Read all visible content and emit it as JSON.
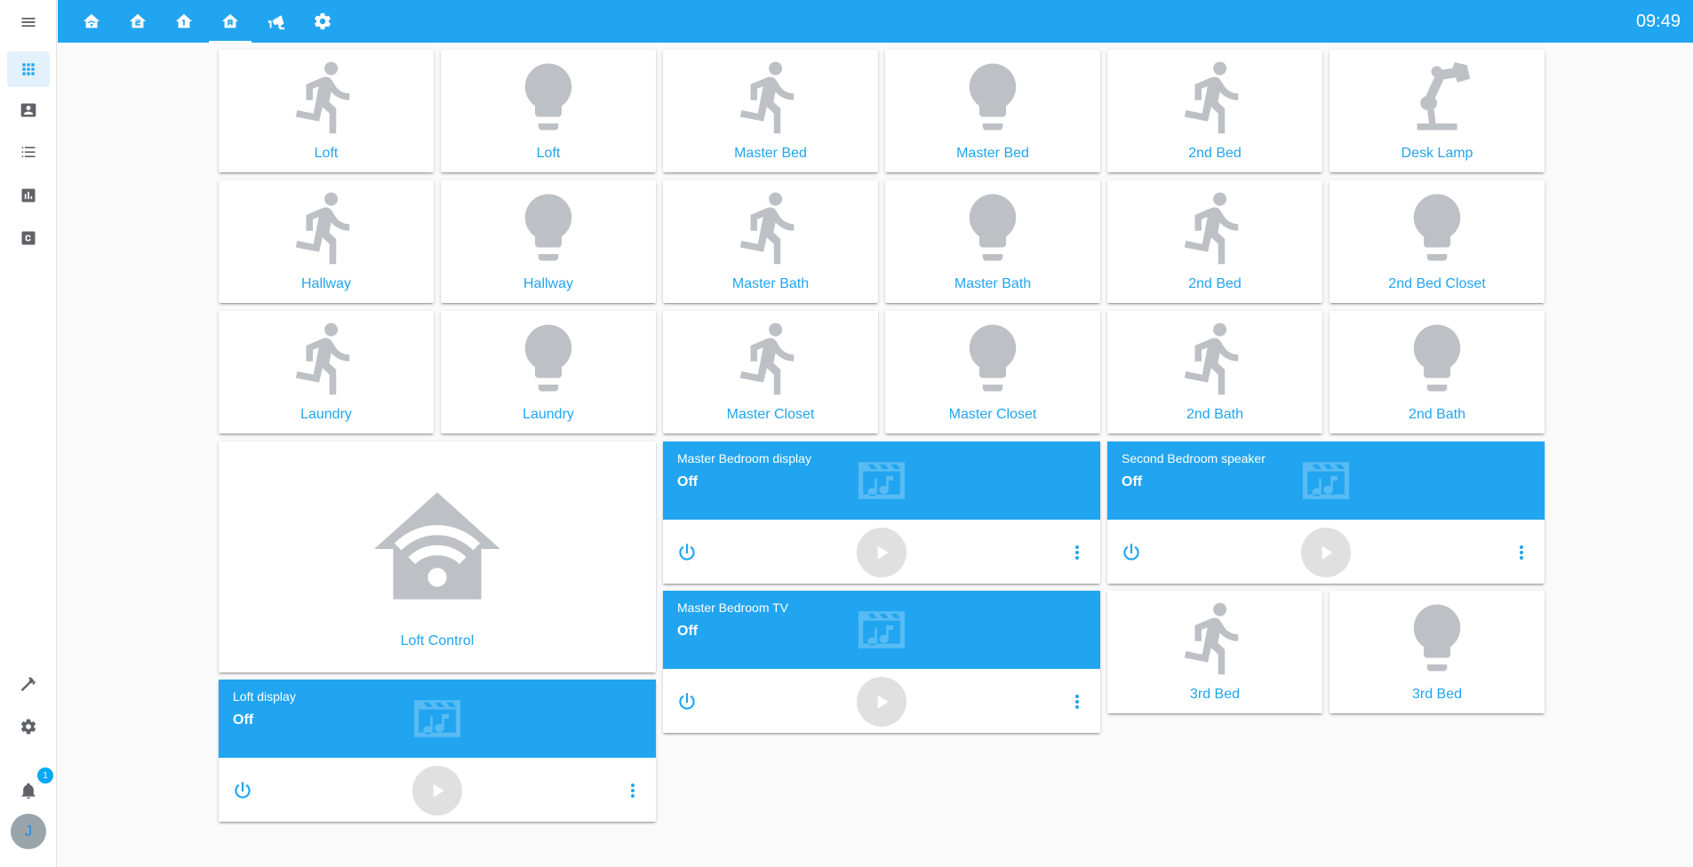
{
  "top": {
    "clock": "09:49",
    "tabs": [
      {
        "name": "home-wifi-icon"
      },
      {
        "name": "home-floor-2-icon"
      },
      {
        "name": "home-floor-1-icon"
      },
      {
        "name": "home-floor-a-icon",
        "active": true
      },
      {
        "name": "cctv-icon"
      },
      {
        "name": "gear-icon"
      }
    ]
  },
  "sidebar": {
    "items": [
      "overview-icon",
      "map-icon",
      "logbook-icon",
      "history-icon",
      "hacs-icon"
    ],
    "bottom": [
      "developer-tools-icon",
      "settings-icon",
      "notifications-icon"
    ],
    "notification_count": "1",
    "avatar_initial": "J"
  },
  "tiles": [
    {
      "label": "Loft",
      "icon": "motion-icon"
    },
    {
      "label": "Loft",
      "icon": "bulb-icon"
    },
    {
      "label": "Master Bed",
      "icon": "motion-icon"
    },
    {
      "label": "Master Bed",
      "icon": "bulb-icon"
    },
    {
      "label": "2nd Bed",
      "icon": "motion-icon"
    },
    {
      "label": "Desk Lamp",
      "icon": "desk-lamp-icon"
    },
    {
      "label": "Hallway",
      "icon": "motion-icon"
    },
    {
      "label": "Hallway",
      "icon": "bulb-icon"
    },
    {
      "label": "Master Bath",
      "icon": "motion-icon"
    },
    {
      "label": "Master Bath",
      "icon": "bulb-icon"
    },
    {
      "label": "2nd Bed",
      "icon": "motion-icon"
    },
    {
      "label": "2nd Bed Closet",
      "icon": "bulb-icon"
    },
    {
      "label": "Laundry",
      "icon": "motion-icon"
    },
    {
      "label": "Laundry",
      "icon": "bulb-icon"
    },
    {
      "label": "Master Closet",
      "icon": "motion-icon"
    },
    {
      "label": "Master Closet",
      "icon": "bulb-icon"
    },
    {
      "label": "2nd Bath",
      "icon": "motion-icon"
    },
    {
      "label": "2nd Bath",
      "icon": "bulb-icon"
    },
    {
      "label": "3rd Bed",
      "icon": "motion-icon"
    },
    {
      "label": "3rd Bed",
      "icon": "bulb-icon"
    }
  ],
  "loft_control": {
    "label": "Loft Control",
    "icon": "home-wifi-icon"
  },
  "media": [
    {
      "name": "Master Bedroom display",
      "state": "Off"
    },
    {
      "name": "Second Bedroom speaker",
      "state": "Off"
    },
    {
      "name": "Master Bedroom TV",
      "state": "Off"
    },
    {
      "name": "Loft display",
      "state": "Off"
    }
  ],
  "colors": {
    "accent": "#21a5f0",
    "icon_gray": "#bdc1c6"
  }
}
